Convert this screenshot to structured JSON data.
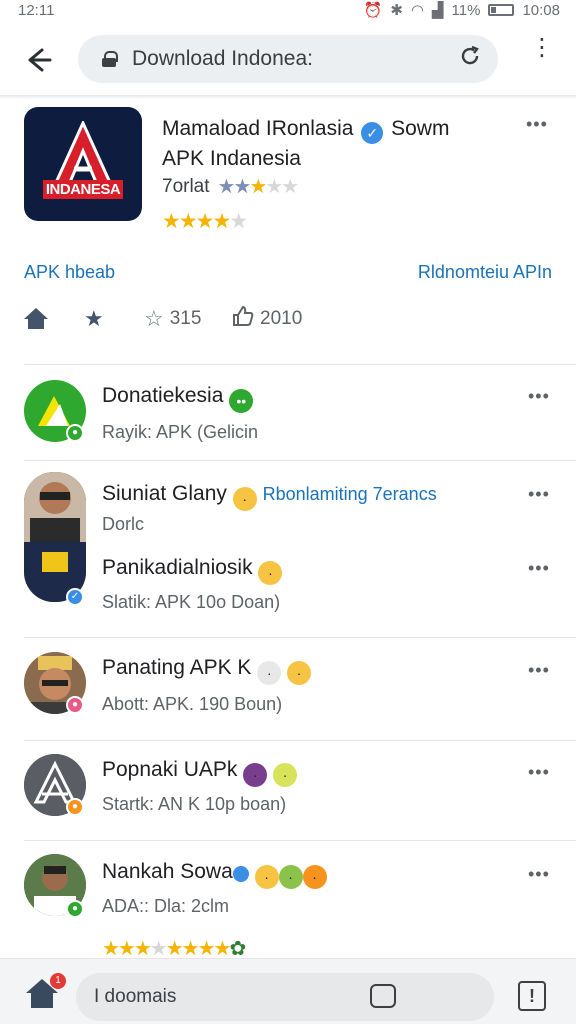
{
  "status_bar": {
    "time": "12:11",
    "battery": "11%",
    "clock_right": "10:08"
  },
  "address_bar": {
    "url": "Download Indonea:",
    "back_icon": "back-arrow-icon",
    "reload_icon": "reload-icon",
    "menu_icon": "more-vert-icon"
  },
  "app": {
    "logo_text": "INDANESA",
    "title_line1_a": "Mamaload IRonlasia",
    "title_line1_b": "Sowm",
    "title_line2": "APK  Indanesia",
    "rating_label": "7orlat",
    "link_left": "APK hbeab",
    "link_right": "Rldnomteiu APIn",
    "stats": [
      {
        "icon": "home-icon",
        "value": ""
      },
      {
        "icon": "star-icon",
        "value": ""
      },
      {
        "icon": "star-outline-icon",
        "value": "315"
      },
      {
        "icon": "thumbs-up-icon",
        "value": "2010"
      }
    ]
  },
  "list": [
    {
      "title": "Donatiekesia",
      "subtitle": "Rayik: APK (Gelicin"
    },
    {
      "title": "Siuniat Glany",
      "link": "Rbonlamiting 7erancs",
      "subtitle": "Dorlc"
    },
    {
      "title": "Panikadialniosik",
      "subtitle": "Slatik: APK 10o Doan)"
    },
    {
      "title": "Panating APK K",
      "subtitle": "Abott: APK. 190 Boun)"
    },
    {
      "title": "Popnaki UAPk",
      "subtitle": "Startk: AN K 10p boan)"
    },
    {
      "title": "Nankah Sowa",
      "subtitle": "ADA:: Dla: 2clm"
    }
  ],
  "bottom_bar": {
    "search_text": "I doomais",
    "notification_count": "1"
  },
  "colors": {
    "accent": "#1a73b8",
    "star": "#f4b400",
    "logo_bg": "#0e1c3f",
    "logo_red": "#d61f2b"
  }
}
